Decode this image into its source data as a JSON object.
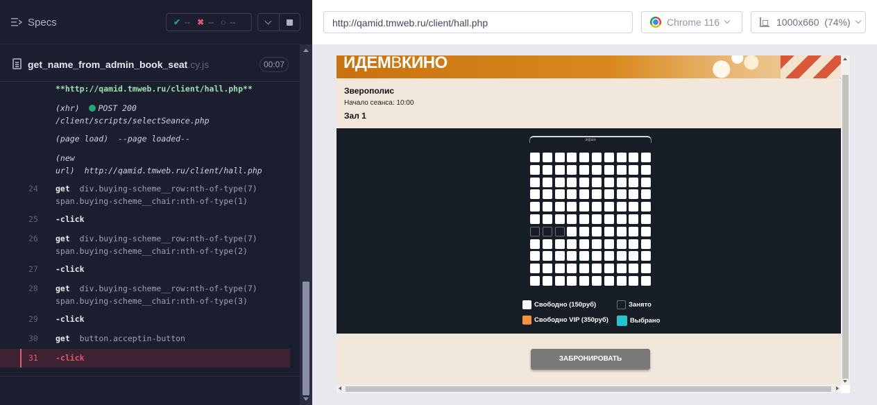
{
  "runner": {
    "specs_label": "Specs",
    "stats": {
      "passed": "--",
      "failed": "--",
      "pending": "--"
    },
    "file": {
      "name": "get_name_from_admin_book_seat",
      "ext": ".cy.js",
      "timer": "00:07"
    }
  },
  "log": {
    "url_line": "**http://qamid.tmweb.ru/client/hall.php**",
    "xhr_tag": "(xhr)",
    "xhr_status": "POST 200",
    "xhr_path": "/client/scripts/selectSeance.php",
    "page_load_tag": "(page load)",
    "page_load_text": "--page loaded--",
    "new_url_tag_1": "(new",
    "new_url_tag_2": "url)",
    "new_url_value": "http://qamid.tmweb.ru/client/hall.php",
    "commands": [
      {
        "num": "24",
        "name": "get",
        "arg1": "div.buying-scheme__row:nth-of-type(7)",
        "arg2": "span.buying-scheme__chair:nth-of-type(1)"
      },
      {
        "num": "25",
        "name": "-click"
      },
      {
        "num": "26",
        "name": "get",
        "arg1": "div.buying-scheme__row:nth-of-type(7)",
        "arg2": "span.buying-scheme__chair:nth-of-type(2)"
      },
      {
        "num": "27",
        "name": "-click"
      },
      {
        "num": "28",
        "name": "get",
        "arg1": "div.buying-scheme__row:nth-of-type(7)",
        "arg2": "span.buying-scheme__chair:nth-of-type(3)"
      },
      {
        "num": "29",
        "name": "-click"
      },
      {
        "num": "30",
        "name": "get",
        "arg1": "button.acceptin-button"
      },
      {
        "num": "31",
        "name": "-click"
      }
    ]
  },
  "browser": {
    "url": "http://qamid.tmweb.ru/client/hall.php",
    "name": "Chrome 116",
    "viewport": "1000x660",
    "zoom": "(74%)"
  },
  "site": {
    "logo_bold_1": "ИДЕМ",
    "logo_thin": "В",
    "logo_bold_2": "КИНО",
    "movie_title": "Зверополис",
    "start_time": "Начало сеанса: 10:00",
    "hall": "Зал 1",
    "screen_label": "экран",
    "legend": {
      "free": "Свободно (150руб)",
      "taken": "Занято",
      "vip": "Свободно VIP (350руб)",
      "selected": "Выбрано"
    },
    "book_button": "ЗАБРОНИРОВАТЬ",
    "colors": {
      "free": "#ffffff",
      "vip": "#f5923e",
      "selected": "#25c4ce",
      "taken": "#171d24"
    },
    "seat_rows": 11,
    "seat_cols": 10,
    "taken_seats": {
      "row": 7,
      "chairs": [
        1,
        2,
        3
      ]
    }
  }
}
